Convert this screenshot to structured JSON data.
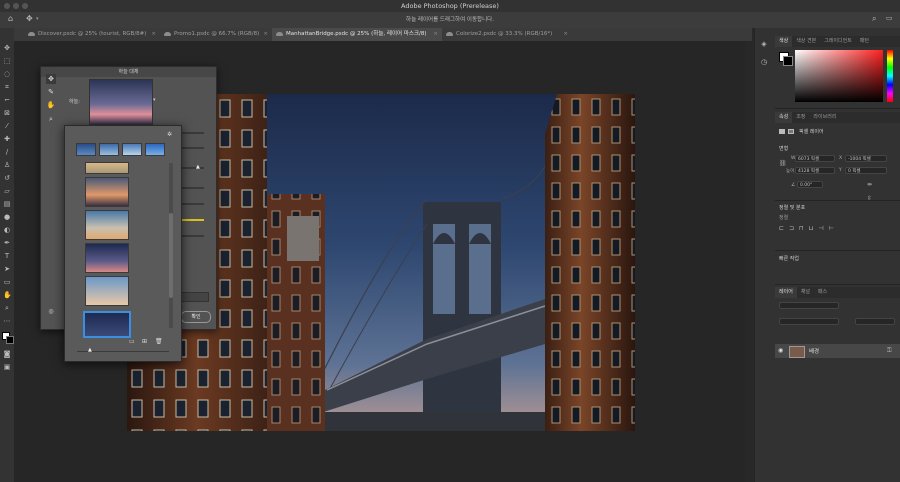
{
  "app": {
    "title": "Adobe Photoshop (Prerelease)"
  },
  "options_bar": {
    "message": "하늘 레이어를 드래그하여 이동합니다."
  },
  "tabs": [
    {
      "label": "Discover.psdc @ 25% (tourist, RGB/8#)"
    },
    {
      "label": "Promo1.psdc @ 66.7% (RGB/8)"
    },
    {
      "label": "ManhattanBridge.psdc @ 25% (하늘, 레이어 마스크/8)"
    },
    {
      "label": "Colorize2.psdc @ 33.3% (RGB/16*)"
    }
  ],
  "tab_close": "×",
  "dialog": {
    "title": "하늘 대체",
    "sky_label": "하늘:",
    "ok_label": "확인"
  },
  "right_panels": {
    "top_tabs": [
      "색상",
      "색상 견본",
      "그레이디언트",
      "패턴"
    ],
    "props_tabs": [
      "속성",
      "조정",
      "라이브러리"
    ],
    "props_layer": "픽셀 레이어",
    "transform_title": "변형",
    "w_label": "W",
    "w_value": "6073 픽셀",
    "x_label": "X",
    "x_value": "-1004 픽셀",
    "h_label": "높이",
    "h_value": "4128 픽셀",
    "y_label": "Y",
    "y_value": "0 픽셀",
    "angle_value": "0.00°",
    "align_title": "정렬 및 분포",
    "align_sub": "정렬",
    "quick_title": "빠른 작업",
    "layers_tabs": [
      "레이어",
      "채널",
      "패스"
    ],
    "layer_name": "배경"
  },
  "colors": {
    "accent": "#3b8fe0",
    "hue_red": "#ff2020"
  }
}
